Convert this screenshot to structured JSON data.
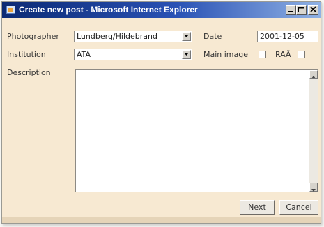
{
  "window": {
    "title": "Create new post - Microsoft Internet Explorer"
  },
  "form": {
    "photographer": {
      "label": "Photographer",
      "value": "Lundberg/Hildebrand"
    },
    "date": {
      "label": "Date",
      "value": "2001-12-05"
    },
    "institution": {
      "label": "Institution",
      "value": "ATA"
    },
    "main_image": {
      "label": "Main image",
      "checked": false
    },
    "raa": {
      "label": "RAÄ",
      "checked": false
    },
    "description": {
      "label": "Description",
      "value": ""
    }
  },
  "buttons": {
    "next": "Next",
    "cancel": "Cancel"
  },
  "icons": {
    "app": "ie-document-icon",
    "minimize": "minimize-icon",
    "maximize": "maximize-icon",
    "close": "close-icon",
    "dropdown": "chevron-down-icon",
    "scroll_up": "scroll-up-icon",
    "scroll_down": "scroll-down-icon"
  },
  "colors": {
    "title_bar_start": "#0b2a74",
    "title_bar_end": "#8fb1e4",
    "dialog_background": "#f7e9d2"
  }
}
